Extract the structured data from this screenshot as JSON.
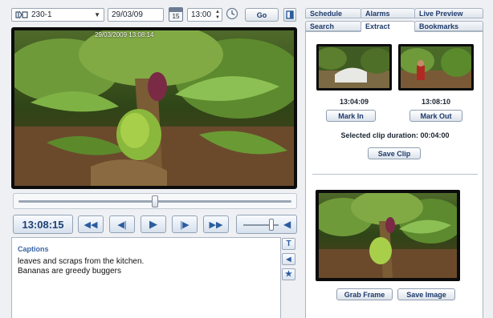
{
  "toolbar": {
    "camera": "230-1",
    "date": "29/03/09",
    "calendar_day": "15",
    "time": "13:00",
    "go_label": "Go"
  },
  "video": {
    "timestamp": "29/03/2009 13:08:14"
  },
  "transport": {
    "current_time": "13:08:15",
    "scrub_position": 0.5,
    "volume_level": 0.8
  },
  "captions": {
    "title": "Captions",
    "lines": [
      "leaves and scraps from the kitchen.",
      "Bananas are greedy buggers"
    ]
  },
  "tabs": {
    "row1": [
      "Schedule",
      "Alarms",
      "Live Preview"
    ],
    "row2": [
      "Search",
      "Extract",
      "Bookmarks"
    ],
    "active": "Extract"
  },
  "extract": {
    "mark_in_time": "13:04:09",
    "mark_out_time": "13:08:10",
    "mark_in_label": "Mark In",
    "mark_out_label": "Mark Out",
    "duration_text": "Selected clip duration: 00:04:00",
    "save_clip_label": "Save Clip",
    "grab_frame_label": "Grab Frame",
    "save_image_label": "Save Image"
  },
  "colors": {
    "accent": "#2b5c9e",
    "tab_text": "#1e3a6b",
    "video_border": "#0c0c0c"
  }
}
